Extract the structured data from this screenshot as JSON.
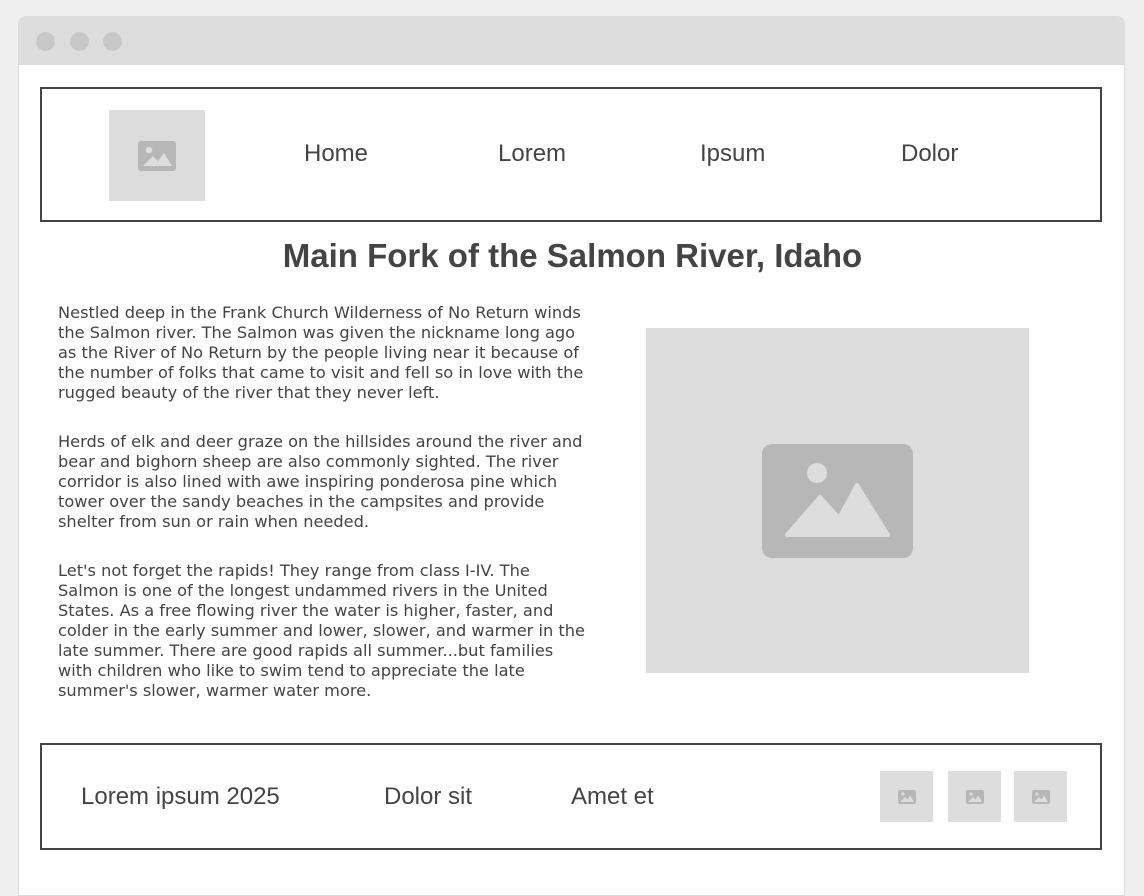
{
  "nav": {
    "items": [
      {
        "label": "Home"
      },
      {
        "label": "Lorem"
      },
      {
        "label": "Ipsum"
      },
      {
        "label": "Dolor"
      }
    ]
  },
  "main": {
    "title": "Main Fork of the Salmon River, Idaho",
    "paragraphs": [
      "Nestled deep in the Frank Church Wilderness of No Return winds the Salmon river. The Salmon was given the nickname long ago as the River of No Return by the people living near it because of the number of folks that came to visit and fell so in love with the rugged beauty of the river that they never left.",
      "Herds of elk and deer graze on the hillsides around the river and bear and bighorn sheep are also commonly sighted. The river corridor is also lined with awe inspiring ponderosa pine which tower over the sandy beaches in the campsites and provide shelter from sun or rain when needed.",
      "Let's not forget the rapids! They range from class I-IV. The Salmon is one of the longest undammed rivers in the United States. As a free flowing river the water is higher, faster, and colder in the early summer and lower, slower, and warmer in the late summer. There are good rapids all summer...but families with children who like to swim tend to appreciate the late summer's slower, warmer water more."
    ],
    "image_icon": "image-placeholder-icon"
  },
  "footer": {
    "links": [
      {
        "label": "Lorem ipsum 2025"
      },
      {
        "label": "Dolor sit"
      },
      {
        "label": "Amet et"
      }
    ],
    "social_icons": [
      "image-placeholder-icon",
      "image-placeholder-icon",
      "image-placeholder-icon"
    ]
  },
  "colors": {
    "text": "#444444",
    "placeholder_bg": "#dddddd",
    "placeholder_icon": "#b7b7b7",
    "titlebar": "#dddddd",
    "page_bg": "#efefef"
  }
}
